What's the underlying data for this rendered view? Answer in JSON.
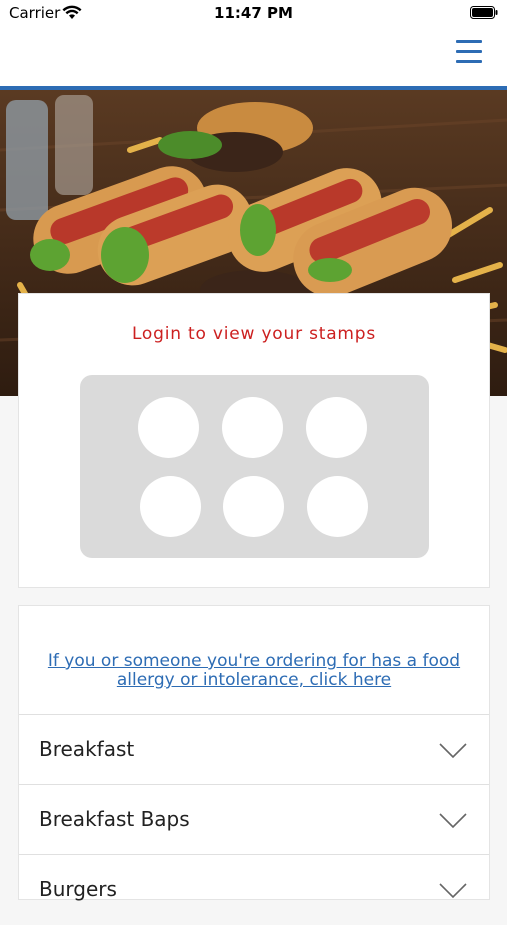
{
  "status_bar": {
    "carrier": "Carrier",
    "time": "11:47 PM"
  },
  "header": {
    "menu_icon": "hamburger-menu-icon",
    "accent_color": "#2d6cb4"
  },
  "hero": {
    "image": "hotdogs-and-burgers-photo"
  },
  "stamps": {
    "title": "Login to view your stamps",
    "title_color": "#cc2020",
    "count": 6
  },
  "allergy": {
    "link_text": "If you or someone you're ordering for has a food allergy or intolerance, click here"
  },
  "menu": {
    "categories": [
      {
        "label": "Breakfast"
      },
      {
        "label": "Breakfast Baps"
      },
      {
        "label": "Burgers"
      }
    ]
  }
}
